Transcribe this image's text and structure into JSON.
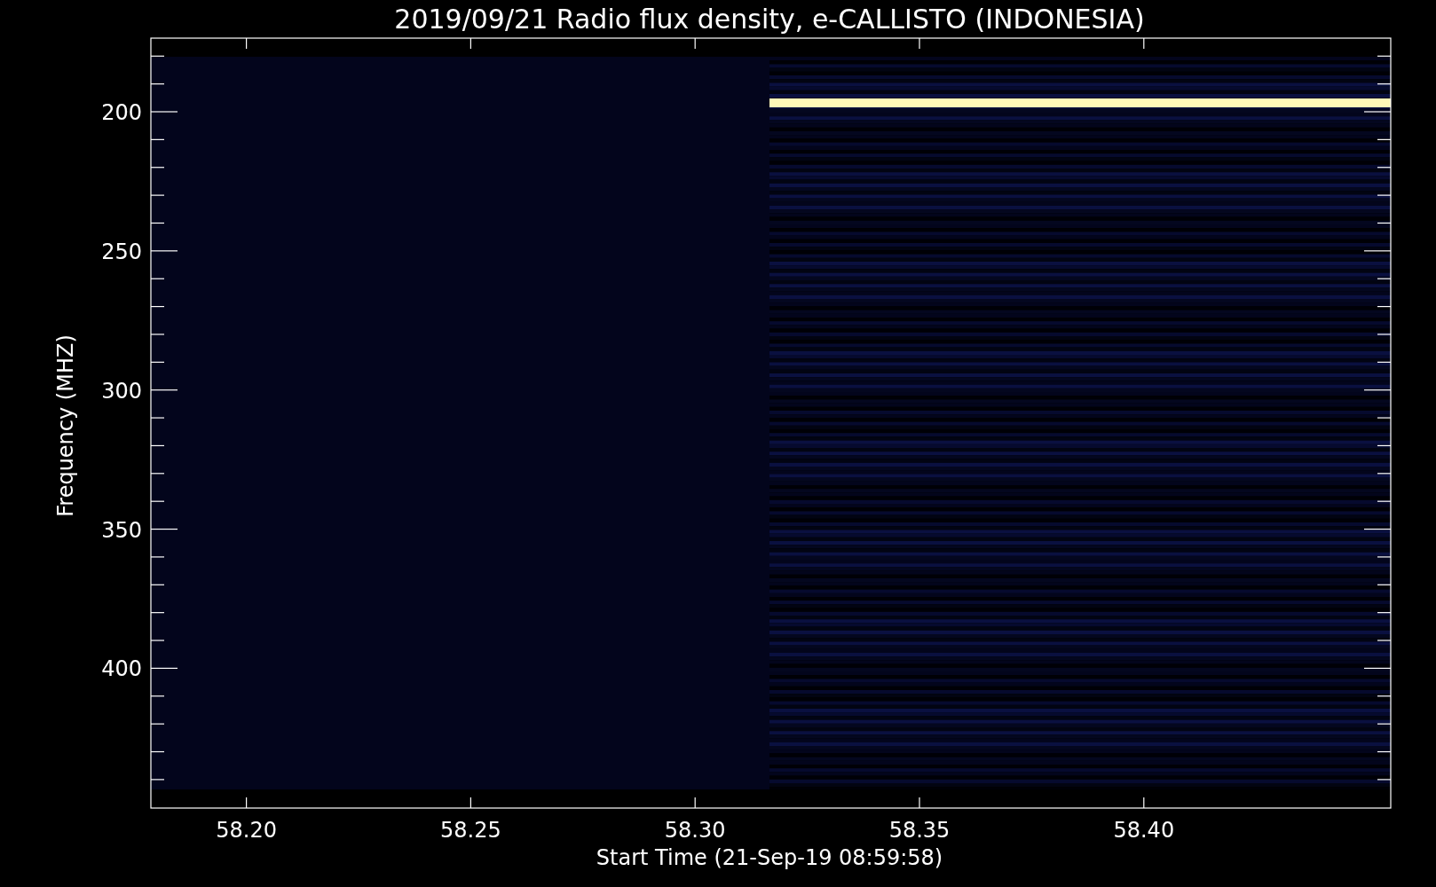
{
  "plot": {
    "title": "2019/09/21  Radio flux density, e-CALLISTO (INDONESIA)",
    "xlabel": "Start Time (21-Sep-19 08:59:58)",
    "ylabel": "Frequency (MHZ)",
    "xticks": [
      "58.20",
      "58.25",
      "58.30",
      "58.35",
      "58.40"
    ],
    "yticks": [
      "200",
      "250",
      "300",
      "350",
      "400"
    ]
  }
}
